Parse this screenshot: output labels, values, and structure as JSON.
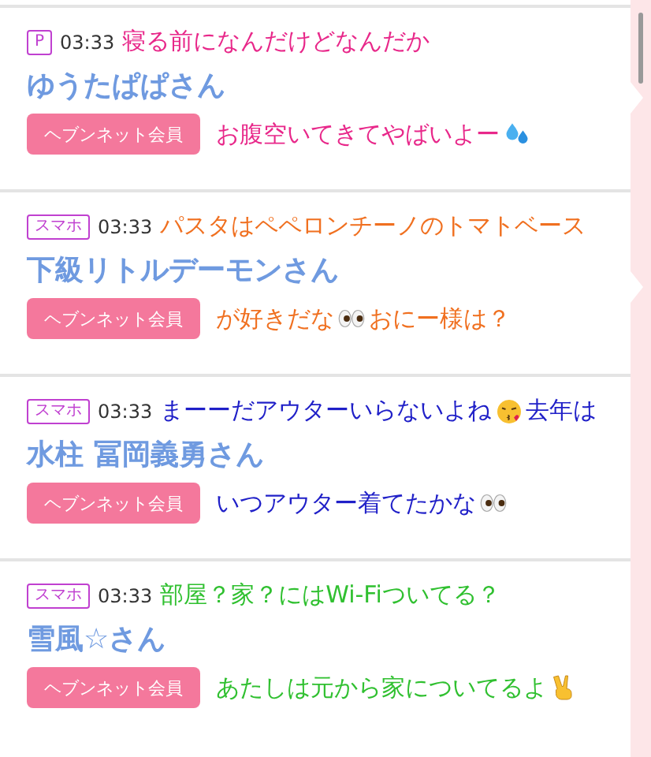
{
  "cards": [
    {
      "tag": "P",
      "time": "03:33",
      "name": "ゆうたぱぱさん",
      "button": "ヘブンネット会員",
      "overlay": {
        "color": "#e8288a",
        "lines": [
          [
            {
              "kind": "text",
              "text": "寝る前になんだけどなんだか"
            }
          ],
          [
            {
              "kind": "text",
              "text": "お腹空いてきてやばいよー"
            },
            {
              "kind": "drops"
            }
          ]
        ]
      }
    },
    {
      "tag": "スマホ",
      "time": "03:33",
      "name": "下級リトルデーモンさん",
      "button": "ヘブンネット会員",
      "overlay": {
        "color": "#f07020",
        "lines": [
          [
            {
              "kind": "text",
              "text": "パスタはペペロンチーノのトマトベース"
            }
          ],
          [
            {
              "kind": "text",
              "text": "が好きだな"
            },
            {
              "kind": "eyes"
            },
            {
              "kind": "text",
              "text": "おにー様は？"
            }
          ]
        ]
      }
    },
    {
      "tag": "スマホ",
      "time": "03:33",
      "name": "水柱 冨岡義勇さん",
      "button": "ヘブンネット会員",
      "overlay": {
        "color": "#2020c8",
        "lines": [
          [
            {
              "kind": "text",
              "text": "まーーだアウターいらないよね"
            },
            {
              "kind": "kiss"
            },
            {
              "kind": "text",
              "text": "去年は"
            }
          ],
          [
            {
              "kind": "text",
              "text": "いつアウター着てたかな"
            },
            {
              "kind": "eyes"
            }
          ]
        ]
      }
    },
    {
      "tag": "スマホ",
      "time": "03:33",
      "name": "雪風☆さん",
      "button": "ヘブンネット会員",
      "overlay": {
        "color": "#30c030",
        "lines": [
          [
            {
              "kind": "text",
              "text": "部屋？家？にはWi-Fiついてる？"
            }
          ],
          [
            {
              "kind": "text",
              "text": "あたしは元から家についてるよ"
            },
            {
              "kind": "peace"
            }
          ]
        ]
      }
    }
  ]
}
